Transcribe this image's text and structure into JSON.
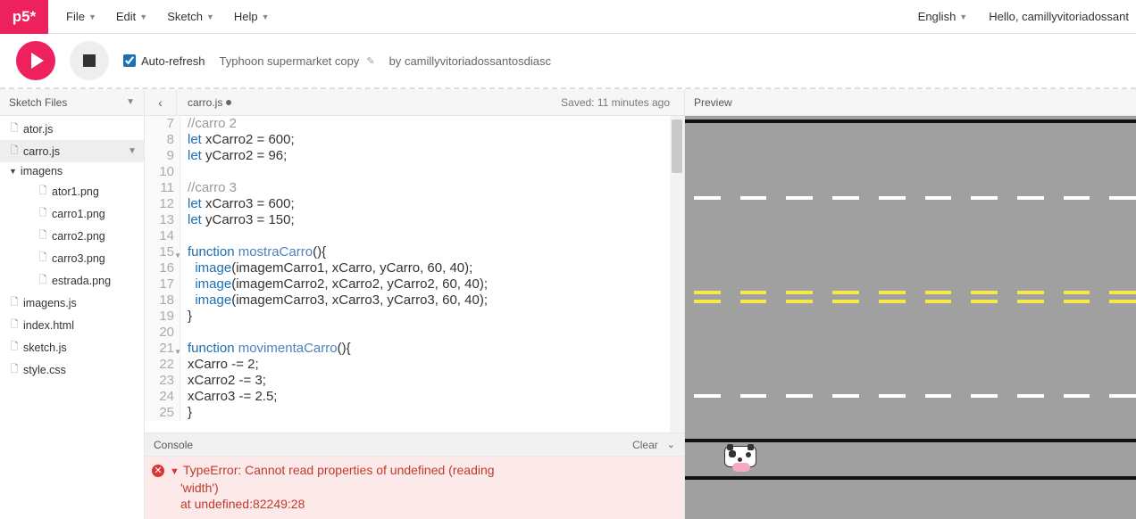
{
  "brand": "p5*",
  "menu": {
    "file": "File",
    "edit": "Edit",
    "sketch": "Sketch",
    "help": "Help"
  },
  "lang": "English",
  "greeting": "Hello, camillyvitoriadossant",
  "toolbar": {
    "autorefresh": "Auto-refresh",
    "sketch_name": "Typhoon supermarket copy",
    "by": "by",
    "author": "camillyvitoriadossantosdiasc"
  },
  "sidebar": {
    "header": "Sketch Files",
    "files": {
      "ator": "ator.js",
      "carro": "carro.js",
      "folder_imagens": "imagens",
      "ator1": "ator1.png",
      "carro1": "carro1.png",
      "carro2": "carro2.png",
      "carro3": "carro3.png",
      "estrada": "estrada.png",
      "imagensjs": "imagens.js",
      "index": "index.html",
      "sketch": "sketch.js",
      "style": "style.css"
    }
  },
  "editor": {
    "tab": "carro.js",
    "saved": "Saved: 11 minutes ago",
    "lines": [
      7,
      8,
      9,
      10,
      11,
      12,
      13,
      14,
      15,
      16,
      17,
      18,
      19,
      20,
      21,
      22,
      23,
      24,
      25
    ]
  },
  "code": {
    "l7": "//carro 2",
    "l8a": "let",
    "l8b": " xCarro2 = ",
    "l8c": "600",
    "l8d": ";",
    "l9a": "let",
    "l9b": " yCarro2 = ",
    "l9c": "96",
    "l9d": ";",
    "l11": "//carro 3",
    "l12a": "let",
    "l12b": " xCarro3 = ",
    "l12c": "600",
    "l12d": ";",
    "l13a": "let",
    "l13b": " yCarro3 = ",
    "l13c": "150",
    "l13d": ";",
    "l15a": "function",
    "l15b": " mostraCarro",
    "l15c": "(){",
    "l16a": "  image",
    "l16b": "(imagemCarro1, xCarro, yCarro, ",
    "l16c": "60",
    "l16d": ", ",
    "l16e": "40",
    "l16f": ");",
    "l17a": "  image",
    "l17b": "(imagemCarro2, xCarro2, yCarro2, ",
    "l17c": "60",
    "l17d": ", ",
    "l17e": "40",
    "l17f": ");",
    "l18a": "  image",
    "l18b": "(imagemCarro3, xCarro3, yCarro3, ",
    "l18c": "60",
    "l18d": ", ",
    "l18e": "40",
    "l18f": ");",
    "l19": "}",
    "l21a": "function",
    "l21b": " movimentaCarro",
    "l21c": "(){",
    "l22": "xCarro -= 2;",
    "l23": "xCarro2 -= 3;",
    "l24": "xCarro3 -= 2.5;",
    "l25": "}"
  },
  "console": {
    "title": "Console",
    "clear": "Clear",
    "err1": "TypeError: Cannot read properties of undefined (reading",
    "err2": "'width')",
    "err3": "    at undefined:82249:28"
  },
  "preview": {
    "title": "Preview"
  }
}
